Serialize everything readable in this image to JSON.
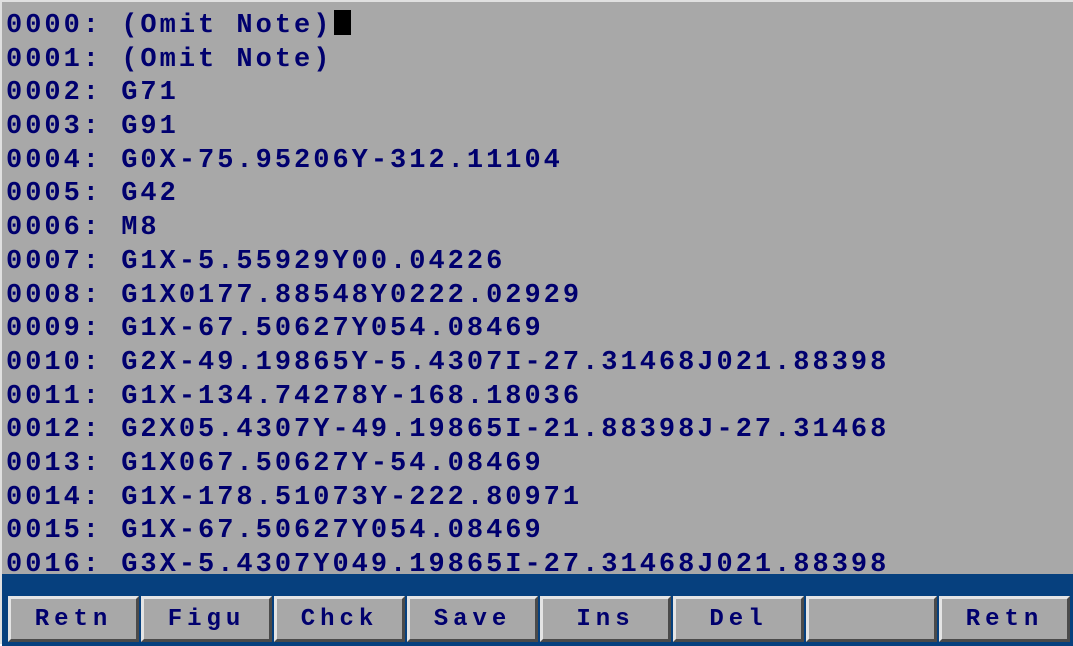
{
  "editor": {
    "lines": [
      {
        "num": "0000:",
        "code": "(Omit Note)"
      },
      {
        "num": "0001:",
        "code": "(Omit Note)"
      },
      {
        "num": "0002:",
        "code": "G71"
      },
      {
        "num": "0003:",
        "code": "G91"
      },
      {
        "num": "0004:",
        "code": "G0X-75.95206Y-312.11104"
      },
      {
        "num": "0005:",
        "code": "G42"
      },
      {
        "num": "0006:",
        "code": "M8"
      },
      {
        "num": "0007:",
        "code": "G1X-5.55929Y00.04226"
      },
      {
        "num": "0008:",
        "code": "G1X0177.88548Y0222.02929"
      },
      {
        "num": "0009:",
        "code": "G1X-67.50627Y054.08469"
      },
      {
        "num": "0010:",
        "code": "G2X-49.19865Y-5.4307I-27.31468J021.88398"
      },
      {
        "num": "0011:",
        "code": "G1X-134.74278Y-168.18036"
      },
      {
        "num": "0012:",
        "code": "G2X05.4307Y-49.19865I-21.88398J-27.31468"
      },
      {
        "num": "0013:",
        "code": "G1X067.50627Y-54.08469"
      },
      {
        "num": "0014:",
        "code": "G1X-178.51073Y-222.80971"
      },
      {
        "num": "0015:",
        "code": "G1X-67.50627Y054.08469"
      },
      {
        "num": "0016:",
        "code": "G3X-5.4307Y049.19865I-27.31468J021.88398"
      }
    ]
  },
  "softkeys": [
    "Retn",
    "Figu",
    "Chck",
    "Save",
    "Ins",
    "Del",
    "",
    "Retn"
  ],
  "softkey_names": [
    "retn-softkey",
    "figu-softkey",
    "chck-softkey",
    "save-softkey",
    "ins-softkey",
    "del-softkey",
    "blank-softkey",
    "retn-softkey-right"
  ],
  "colors": {
    "background": "#a8a8a8",
    "text": "#00006e",
    "bottom_bar": "#06407e",
    "cursor": "#000000"
  }
}
